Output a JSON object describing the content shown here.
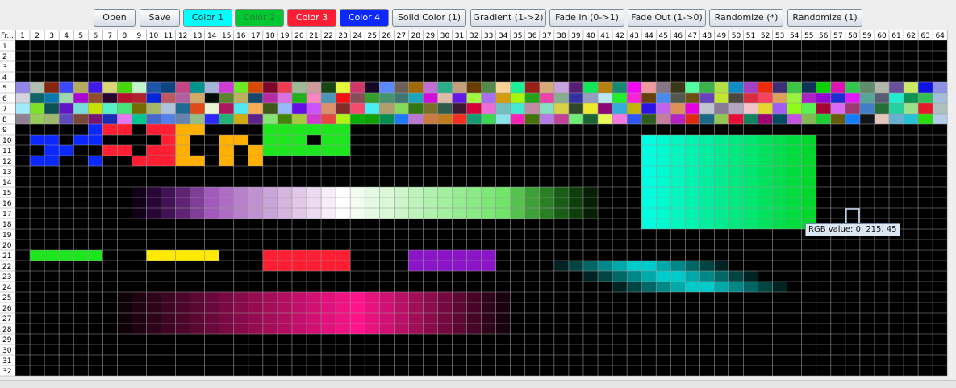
{
  "toolbar": {
    "buttons": [
      {
        "label": "Open"
      },
      {
        "label": "Save"
      },
      {
        "label": "Color 1",
        "bg": "#00ffff",
        "fg": "#333333"
      },
      {
        "label": "Color 2",
        "bg": "#00c832",
        "fg": "#2f7a2f"
      },
      {
        "label": "Color 3",
        "bg": "#ff1e32",
        "fg": "#ffffff"
      },
      {
        "label": "Color 4",
        "bg": "#0a28ff",
        "fg": "#ffffff"
      },
      {
        "label": "Solid Color (1)"
      },
      {
        "label": "Gradient (1->2)"
      },
      {
        "label": "Fade In (0->1)"
      },
      {
        "label": "Fade Out (1->0)"
      },
      {
        "label": "Randomize (*)"
      },
      {
        "label": "Randomize (1)"
      }
    ]
  },
  "grid": {
    "corner_label": "Fr...",
    "columns": 64,
    "rows": 32,
    "background": "#000000",
    "line_color": "#999999"
  },
  "tooltip": {
    "text": "RGB value: 0, 215, 45"
  }
}
